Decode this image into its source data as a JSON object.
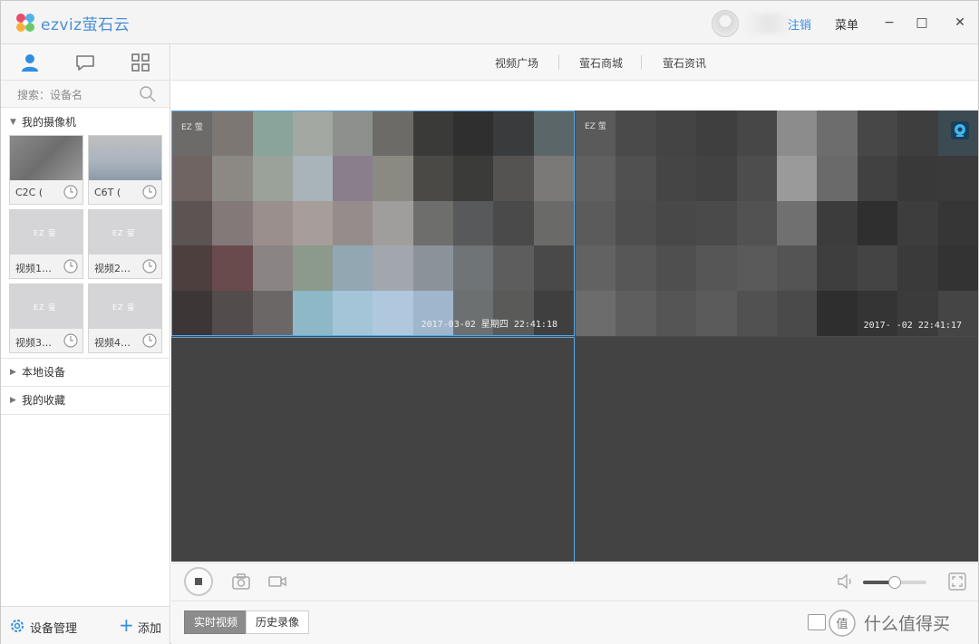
{
  "app": {
    "brand": "ezviz萤石云",
    "logout": "注销",
    "menu": "菜单",
    "window_buttons": {
      "minimize": "−",
      "maximize": "□",
      "close": "✕"
    }
  },
  "left_panel": {
    "tabs": [
      "person-icon",
      "chat-icon",
      "grid-icon"
    ],
    "search_placeholder": "搜索：设备名",
    "groups": [
      {
        "label": "我的摄像机",
        "expanded": true
      },
      {
        "label": "本地设备",
        "expanded": false
      },
      {
        "label": "我的收藏",
        "expanded": false
      }
    ],
    "cameras": [
      {
        "name": "C2C ("
      },
      {
        "name": "C6T ("
      },
      {
        "name": "视频1…"
      },
      {
        "name": "视频2…"
      },
      {
        "name": "视频3…"
      },
      {
        "name": "视频4…"
      }
    ],
    "device_mgmt": "设备管理",
    "add": "添加"
  },
  "top_nav": {
    "items": [
      "视频广场",
      "萤石商城",
      "萤石资讯"
    ]
  },
  "video_grid": {
    "panes": [
      {
        "timestamp": "2017-03-02 星期四 22:41:18",
        "active": true
      },
      {
        "timestamp": "2017-  -02 22:41:17",
        "active": false
      },
      {
        "timestamp": "",
        "active": false
      },
      {
        "timestamp": "",
        "active": false
      }
    ],
    "mini_logo": "EZ 萤"
  },
  "controls": {
    "volume": 0.5
  },
  "mode_bar": {
    "live": "实时视频",
    "history": "历史录像"
  },
  "watermark": "值 什么值得买",
  "colors": {
    "accent": "#3a8ee6",
    "selected_border": "#56a7e6",
    "grid_bg": "#434343"
  }
}
